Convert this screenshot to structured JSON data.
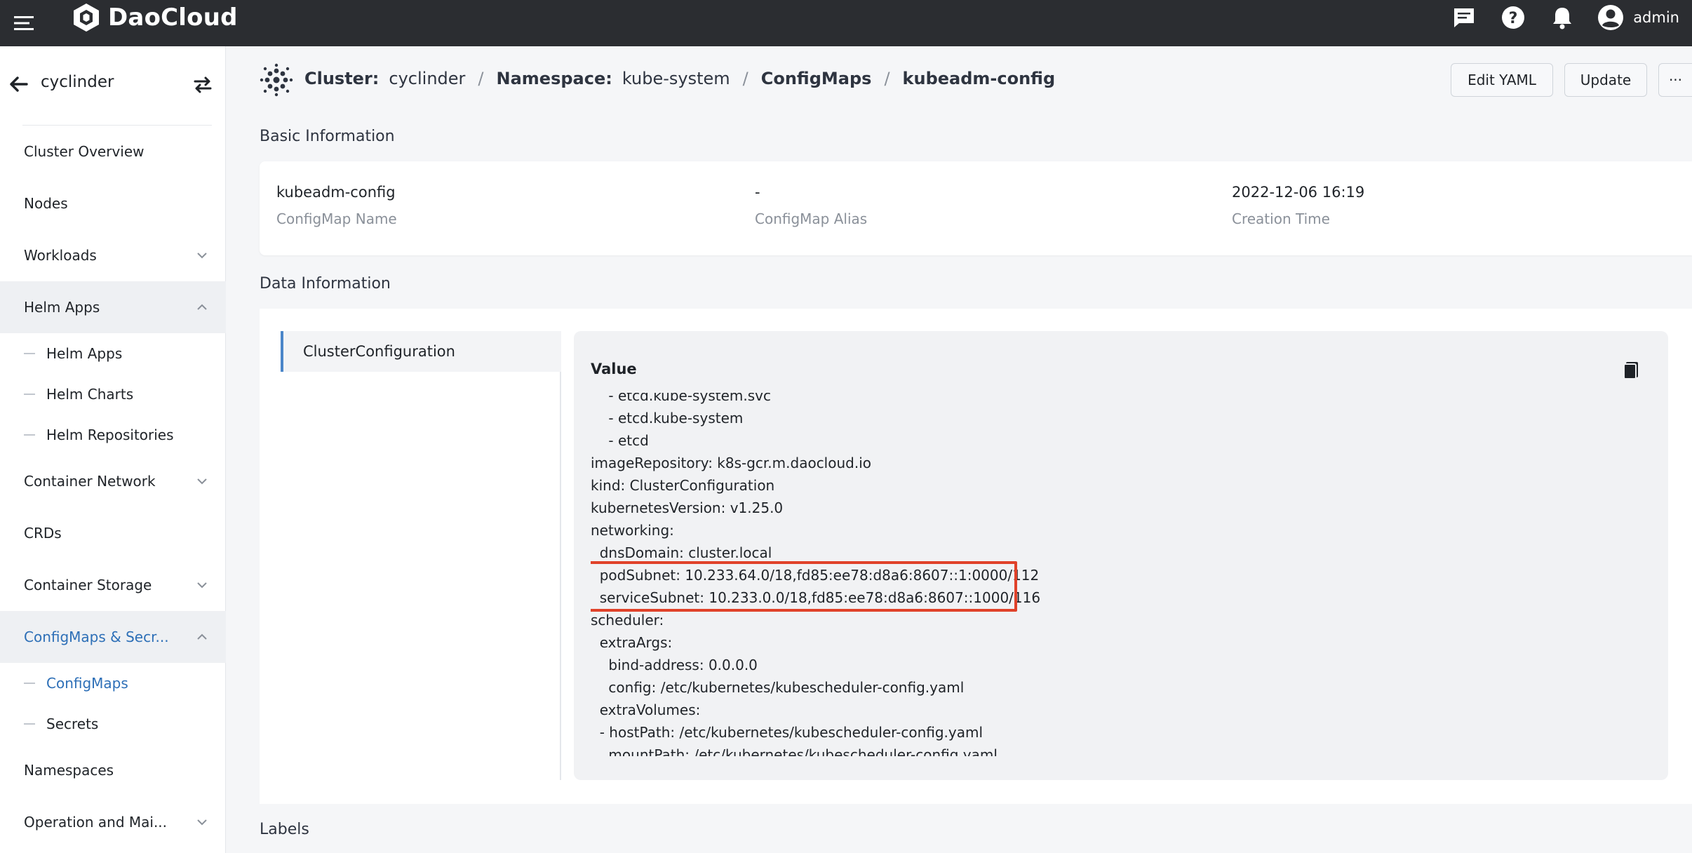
{
  "topbar": {
    "brand": "DaoCloud",
    "user": "admin",
    "icons": [
      "menu-icon",
      "daocloud-logo-icon",
      "message-icon",
      "help-icon",
      "bell-icon",
      "user-avatar-icon"
    ]
  },
  "sidebar": {
    "cluster_name": "cyclinder",
    "items": [
      {
        "label": "Cluster Overview"
      },
      {
        "label": "Nodes"
      },
      {
        "label": "Workloads"
      },
      {
        "label": "Helm Apps"
      },
      {
        "label": "Container Network"
      },
      {
        "label": "CRDs"
      },
      {
        "label": "Container Storage"
      },
      {
        "label": "ConfigMaps & Secr..."
      },
      {
        "label": "Namespaces"
      },
      {
        "label": "Operation and Mai..."
      }
    ],
    "helm_sub": [
      "Helm Apps",
      "Helm Charts",
      "Helm Repositories"
    ],
    "config_sub": [
      "ConfigMaps",
      "Secrets"
    ]
  },
  "breadcrumb": {
    "cluster_label": "Cluster:",
    "cluster_value": "cyclinder",
    "namespace_label": "Namespace:",
    "namespace_value": "kube-system",
    "section": "ConfigMaps",
    "current": "kubeadm-config"
  },
  "actions": {
    "edit_yaml": "Edit YAML",
    "update": "Update",
    "more": "···"
  },
  "basic_info": {
    "title": "Basic Information",
    "name_value": "kubeadm-config",
    "name_label": "ConfigMap Name",
    "alias_value": "-",
    "alias_label": "ConfigMap Alias",
    "created_value": "2022-12-06 16:19",
    "created_label": "Creation Time"
  },
  "data_info": {
    "title": "Data Information",
    "tab": "ClusterConfiguration",
    "value_title": "Value",
    "lines": [
      "    - etcd.kube-system.svc",
      "    - etcd.kube-system",
      "    - etcd",
      "imageRepository: k8s-gcr.m.daocloud.io",
      "kind: ClusterConfiguration",
      "kubernetesVersion: v1.25.0",
      "networking:",
      "  dnsDomain: cluster.local",
      "  podSubnet: 10.233.64.0/18,fd85:ee78:d8a6:8607::1:0000/112",
      "  serviceSubnet: 10.233.0.0/18,fd85:ee78:d8a6:8607::1000/116",
      "scheduler:",
      "  extraArgs:",
      "    bind-address: 0.0.0.0",
      "    config: /etc/kubernetes/kubescheduler-config.yaml",
      "  extraVolumes:",
      "  - hostPath: /etc/kubernetes/kubescheduler-config.yaml",
      "    mountPath: /etc/kubernetes/kubescheduler-config.yaml"
    ]
  },
  "labels": {
    "title": "Labels"
  },
  "colors": {
    "topbar": "#2b2d31",
    "accent": "#2d6fb7",
    "highlight": "#e0422a"
  }
}
